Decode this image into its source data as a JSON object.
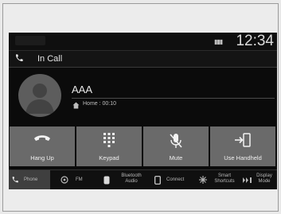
{
  "status": {
    "clock": "12:34"
  },
  "header": {
    "title": "In Call"
  },
  "contact": {
    "name": "AAA",
    "detail": "Home : 00:10"
  },
  "actions": [
    {
      "label": "Hang Up",
      "icon": "hang-up-icon"
    },
    {
      "label": "Keypad",
      "icon": "keypad-icon"
    },
    {
      "label": "Mute",
      "icon": "mute-icon"
    },
    {
      "label": "Use Handheld",
      "icon": "handheld-icon"
    }
  ],
  "sources": [
    {
      "label": "Phone",
      "icon": "phone-icon",
      "active": true
    },
    {
      "label": "FM",
      "icon": "radio-icon"
    },
    {
      "label_line1": "Bluetooth",
      "label_line2": "Audio",
      "icon": "bluetooth-icon"
    },
    {
      "label": "Connect",
      "icon": "connect-icon"
    },
    {
      "label_line1": "Smart",
      "label_line2": "Shortcuts",
      "icon": "shortcuts-icon"
    },
    {
      "label_line1": "Display",
      "label_line2": "Mode",
      "icon": "display-mode-icon"
    }
  ],
  "colors": {
    "screen_bg": "#0b0b0b",
    "tile_bg": "#6a6a6a",
    "text": "#e8e8e8"
  }
}
